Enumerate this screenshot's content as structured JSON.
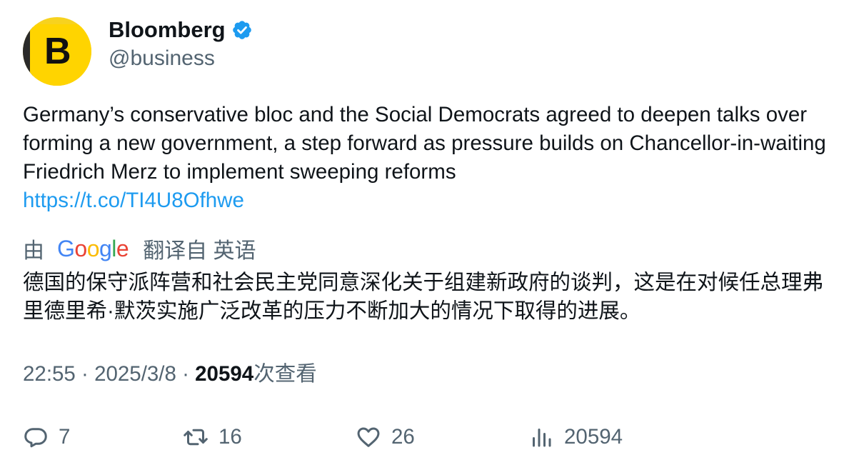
{
  "author": {
    "avatar_letter": "B",
    "display_name": "Bloomberg",
    "handle": "@business",
    "verified": true
  },
  "tweet": {
    "text": "Germany’s conservative bloc and the Social Democrats agreed to deepen talks over forming a new government, a step forward as pressure builds on Chancellor-in-waiting Friedrich Merz to implement sweeping reforms",
    "link": "https://t.co/TI4U8Ofhwe"
  },
  "translation": {
    "prefix": "由",
    "provider": "Google",
    "suffix": "翻译自 英语",
    "text": "德国的保守派阵营和社会民主党同意深化关于组建新政府的谈判，这是在对候任总理弗里德里希·默茨实施广泛改革的压力不断加大的情况下取得的进展。"
  },
  "meta": {
    "time": "22:55",
    "separator": "·",
    "date": "2025/3/8",
    "views_count": "20594",
    "views_label": "次查看"
  },
  "actions": {
    "replies": "7",
    "retweets": "16",
    "likes": "26",
    "views": "20594"
  },
  "colors": {
    "text": "#0f1419",
    "secondary": "#536471",
    "link": "#1d9bf0",
    "verified_badge": "#1d9bf0",
    "avatar_bg": "#ffd400"
  },
  "icons": [
    "verified-badge-icon",
    "reply-icon",
    "retweet-icon",
    "like-icon",
    "views-icon"
  ]
}
